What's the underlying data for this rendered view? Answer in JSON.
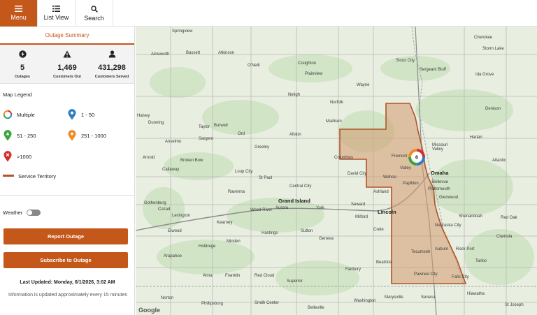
{
  "topbar": {
    "menu_label": "Menu",
    "list_label": "List View",
    "search_label": "Search"
  },
  "summary": {
    "tab_label": "Outage Summary",
    "outages_value": "5",
    "outages_label": "Outages",
    "customers_out_value": "1,469",
    "customers_out_label": "Customers Out",
    "customers_served_value": "431,298",
    "customers_served_label": "Customers Served"
  },
  "legend": {
    "title": "Map Legend",
    "multiple": "Multiple",
    "range_1_50": "1 - 50",
    "range_51_250": "51 - 250",
    "range_251_1000": "251 - 1000",
    "range_over_1000": ">1000",
    "territory": "Service Territory",
    "colors": {
      "r1_50": "#2f7fc4",
      "r51_250": "#3aa53a",
      "r251_1000": "#f08a24",
      "over_1000": "#d12f2f",
      "territory": "#b0542a"
    }
  },
  "weather_label": "Weather",
  "report_button": "Report Outage",
  "subscribe_button": "Subscribe to Outage",
  "last_updated": "Last Updated: Monday, 6/1/2026, 3:02 AM",
  "info_text": "Information is updated approximately every 15 minutes",
  "map": {
    "cluster_count": "6",
    "attribution": "Google",
    "cities": [
      "Springview",
      "Ainsworth",
      "Bassett",
      "Atkinson",
      "O'Neill",
      "Creighton",
      "Plainview",
      "Wayne",
      "Sioux City",
      "Sergeant Bluff",
      "Cherokee",
      "Storm Lake",
      "Ida Grove",
      "Denison",
      "Harlan",
      "Atlantic",
      "Halsey",
      "Dunning",
      "Taylor",
      "Burwell",
      "Albion",
      "Madison",
      "Norfolk",
      "Neligh",
      "Columbus",
      "David City",
      "Wahoo",
      "Fremont",
      "Valley",
      "Omaha",
      "Papillion",
      "Bellevue",
      "Missouri Valley",
      "Broken Bow",
      "Callaway",
      "Arnold",
      "Anselmo",
      "Sargent",
      "Ord",
      "Greeley",
      "St Paul",
      "Loup City",
      "Central City",
      "Grand Island",
      "Aurora",
      "York",
      "Seward",
      "Lincoln",
      "Milford",
      "Crete",
      "Wood River",
      "Kearney",
      "Lexington",
      "Gothenburg",
      "Cozad",
      "Elwood",
      "Holdrege",
      "Minden",
      "Hastings",
      "Sutton",
      "Geneva",
      "Beatrice",
      "Tecumseh",
      "Auburn",
      "Nebraska City",
      "Shenandoah",
      "Red Oak",
      "Rock Port",
      "Clarinda",
      "Tarkio",
      "Falls City",
      "Pawnee City",
      "Marysville",
      "Seneca",
      "Hiawatha",
      "St Joseph",
      "Belleville",
      "Superior",
      "Red Cloud",
      "Franklin",
      "Alma",
      "Phillipsburg",
      "Norton",
      "Smith Center",
      "Fairbury",
      "Arapahoe",
      "Ravenna",
      "Ashland",
      "Glenwood",
      "Washington",
      "Plattsmouth"
    ]
  }
}
